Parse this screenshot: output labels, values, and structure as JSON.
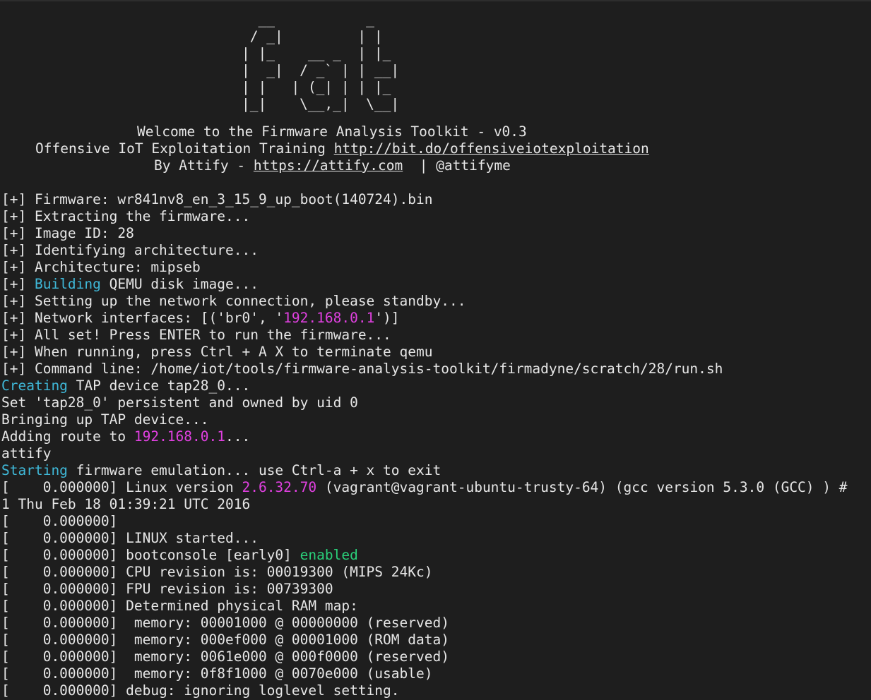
{
  "banner": {
    "art": "  __           _\n / _|         | |\n| |_    __ _  | |_\n|  _|  / _` | | __|\n| |   | (_| | | |_\n|_|    \\__,_|  \\__|",
    "welcome": "Welcome to the Firmware Analysis Toolkit - v0.3",
    "training_prefix": "Offensive IoT Exploitation Training ",
    "training_link": "http://bit.do/offensiveiotexploitation",
    "by_prefix": "By Attify - ",
    "by_link": "https://attify.com",
    "by_suffix": "  | @attifyme"
  },
  "log": {
    "l01": "[+] Firmware: wr841nv8_en_3_15_9_up_boot(140724).bin",
    "l02": "[+] Extracting the firmware...",
    "l03": "[+] Image ID: 28",
    "l04": "[+] Identifying architecture...",
    "l05": "[+] Architecture: mipseb",
    "l06_a": "[+] ",
    "l06_b": "Building",
    "l06_c": " QEMU disk image...",
    "l07": "[+] Setting up the network connection, please standby...",
    "l08_a": "[+] Network interfaces: [('br0', '",
    "l08_b": "192.168.0.1",
    "l08_c": "')]",
    "l09": "[+] All set! Press ENTER to run the firmware...",
    "l10": "[+] When running, press Ctrl + A X to terminate qemu",
    "l11": "[+] Command line: /home/iot/tools/firmware-analysis-toolkit/firmadyne/scratch/28/run.sh",
    "l12_a": "Creating",
    "l12_b": " TAP device tap28_0...",
    "l13": "Set 'tap28_0' persistent and owned by uid 0",
    "l14": "Bringing up TAP device...",
    "l15_a": "Adding route to ",
    "l15_b": "192.168.0.1",
    "l15_c": "...",
    "l16": "attify",
    "l17_a": "Starting",
    "l17_b": " firmware emulation... use Ctrl-a + x to exit",
    "l18_a": "[    0.000000] Linux version ",
    "l18_b": "2.6.32.70",
    "l18_c": " (vagrant@vagrant-ubuntu-trusty-64) (gcc version 5.3.0 (GCC) ) #",
    "l19": "1 Thu Feb 18 01:39:21 UTC 2016",
    "l20": "[    0.000000]",
    "l21": "[    0.000000] LINUX started...",
    "l22_a": "[    0.000000] bootconsole [early0] ",
    "l22_b": "enabled",
    "l23": "[    0.000000] CPU revision is: 00019300 (MIPS 24Kc)",
    "l24": "[    0.000000] FPU revision is: 00739300",
    "l25": "[    0.000000] Determined physical RAM map:",
    "l26": "[    0.000000]  memory: 00001000 @ 00000000 (reserved)",
    "l27": "[    0.000000]  memory: 000ef000 @ 00001000 (ROM data)",
    "l28": "[    0.000000]  memory: 0061e000 @ 000f0000 (reserved)",
    "l29": "[    0.000000]  memory: 0f8f1000 @ 0070e000 (usable)",
    "l30": "[    0.000000] debug: ignoring loglevel setting."
  },
  "colors": {
    "background": "#1e1e1e",
    "text": "#e6e6e6",
    "keyword_cyan": "#3fb8d8",
    "ip_magenta": "#e040e0",
    "enabled_green": "#2ad07a"
  }
}
